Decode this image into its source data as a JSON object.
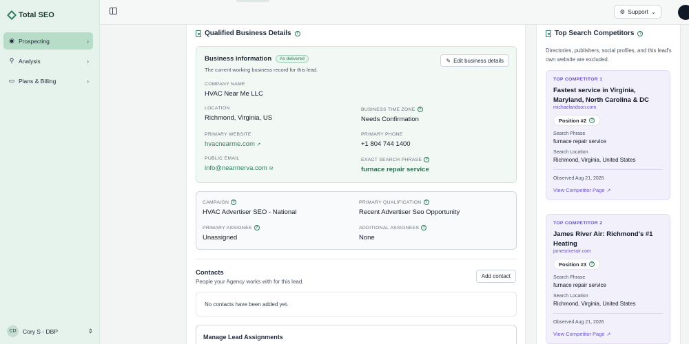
{
  "app": {
    "title": "Total SEO"
  },
  "sidebar": {
    "items": [
      {
        "label": "Prospecting",
        "icon": "globe-icon"
      },
      {
        "label": "Analysis",
        "icon": "search-icon"
      },
      {
        "label": "Plans & Billing",
        "icon": "card-icon"
      }
    ],
    "user": {
      "initials": "CD",
      "name": "Cory S - DBP"
    }
  },
  "topbar": {
    "support_label": "Support"
  },
  "main": {
    "title": "Qualified Business Details",
    "business": {
      "title": "Business information",
      "badge": "As delivered",
      "subtitle": "The current working business record for this lead.",
      "edit_label": "Edit business details",
      "company_name": {
        "label": "COMPANY NAME",
        "value": "HVAC Near Me LLC"
      },
      "location": {
        "label": "LOCATION",
        "value": "Richmond, Virginia, US"
      },
      "time_zone": {
        "label": "BUSINESS TIME ZONE",
        "value": "Needs Confirmation"
      },
      "website": {
        "label": "PRIMARY WEBSITE",
        "value": "hvacnearme.com"
      },
      "phone": {
        "label": "PRIMARY PHONE",
        "value": "+1 804 744 1400"
      },
      "email": {
        "label": "PUBLIC EMAIL",
        "value": "info@nearmerva.com"
      },
      "search_phrase": {
        "label": "EXACT SEARCH PHRASE",
        "value": "furnace repair service"
      }
    },
    "campaign": {
      "campaign": {
        "label": "CAMPAIGN",
        "value": "HVAC Advertiser SEO - National"
      },
      "qualification": {
        "label": "PRIMARY QUALIFICATION",
        "value": "Recent Advertiser Seo Opportunity"
      },
      "assignee": {
        "label": "PRIMARY ASSIGNEE",
        "value": "Unassigned"
      },
      "additional": {
        "label": "ADDITIONAL ASSIGNEES",
        "value": "None"
      }
    },
    "contacts": {
      "title": "Contacts",
      "subtitle": "People your Agency works with for this lead.",
      "add_label": "Add contact",
      "empty": "No contacts have been added yet."
    },
    "assignments": {
      "title": "Manage Lead Assignments"
    }
  },
  "competitors": {
    "title": "Top Search Competitors",
    "description": "Directories, publishers, social profiles, and this lead's own website are excluded.",
    "search_phrase_label": "Search Phrase",
    "search_location_label": "Search Location",
    "view_label": "View Competitor Page",
    "items": [
      {
        "tag": "TOP COMPETITOR 1",
        "name": "Fastest service in Virginia, Maryland, North Carolina & DC",
        "domain": "michaelandson.com",
        "position": "Position #2",
        "phrase": "furnace repair service",
        "location": "Richmond, Virginia, United States",
        "observed": "Observed Aug 21, 2026"
      },
      {
        "tag": "TOP COMPETITOR 2",
        "name": "James River Air: Richmond's #1 Heating",
        "domain": "jamesriverair.com",
        "position": "Position #3",
        "phrase": "furnace repair service",
        "location": "Richmond, Virginia, United States",
        "observed": "Observed Aug 21, 2026"
      }
    ]
  }
}
